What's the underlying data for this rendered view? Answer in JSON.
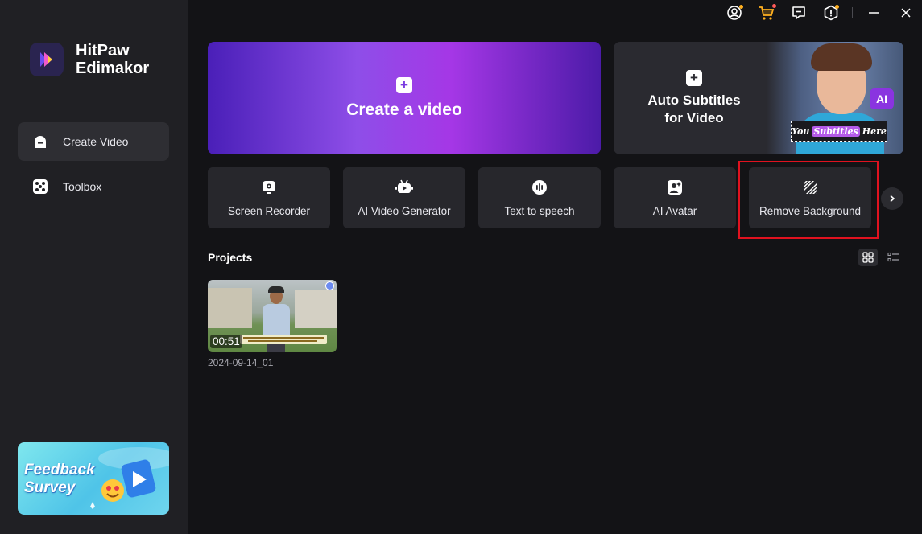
{
  "app": {
    "name_line1": "HitPaw",
    "name_line2": "Edimakor"
  },
  "sidebar": {
    "items": [
      {
        "label": "Create Video",
        "icon": "create-video-icon",
        "active": true
      },
      {
        "label": "Toolbox",
        "icon": "toolbox-icon",
        "active": false
      }
    ],
    "feedback_banner": {
      "line1": "Feedback",
      "line2": "Survey"
    }
  },
  "window_controls": [
    "account-icon",
    "cart-icon",
    "feedback-icon",
    "settings-icon",
    "minimize-icon",
    "close-icon"
  ],
  "hero": {
    "create": {
      "label": "Create a video",
      "icon": "plus-icon"
    },
    "subtitles": {
      "line1": "Auto Subtitles",
      "line2": "for Video",
      "ai_badge": "AI",
      "sample_words": [
        "You",
        "Subtitles",
        "Here"
      ]
    }
  },
  "tools": [
    {
      "label": "Screen Recorder",
      "icon": "screen-recorder-icon"
    },
    {
      "label": "AI Video Generator",
      "icon": "ai-video-generator-icon"
    },
    {
      "label": "Text to speech",
      "icon": "text-to-speech-icon"
    },
    {
      "label": "AI Avatar",
      "icon": "ai-avatar-icon"
    },
    {
      "label": "Remove Background",
      "icon": "remove-background-icon",
      "highlighted": true
    }
  ],
  "projects": {
    "title": "Projects",
    "view_mode": "grid",
    "items": [
      {
        "name": "2024-09-14_01",
        "duration": "00:51"
      }
    ]
  },
  "colors": {
    "sidebar_bg": "#202024",
    "main_bg": "#131316",
    "accent_purple": "#a537e6",
    "highlight_red": "#e0121f"
  }
}
